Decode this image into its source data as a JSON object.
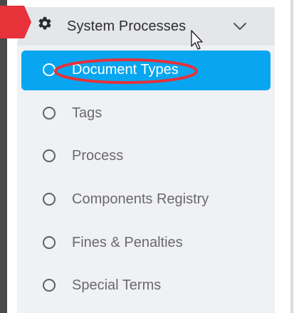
{
  "menu": {
    "section_title": "System Processes",
    "section_icon": "gear-icon",
    "expand_icon": "chevron-down-icon",
    "items": [
      {
        "label": "Document Types",
        "active": true
      },
      {
        "label": "Tags",
        "active": false
      },
      {
        "label": "Process",
        "active": false
      },
      {
        "label": "Components Registry",
        "active": false
      },
      {
        "label": "Fines & Penalties",
        "active": false
      },
      {
        "label": "Special Terms",
        "active": false
      }
    ]
  },
  "colors": {
    "active_item": "#08a6f0",
    "annotation": "#e5323a",
    "header_bg": "#e4e6ea",
    "submenu_bg": "#f0f1f5"
  }
}
